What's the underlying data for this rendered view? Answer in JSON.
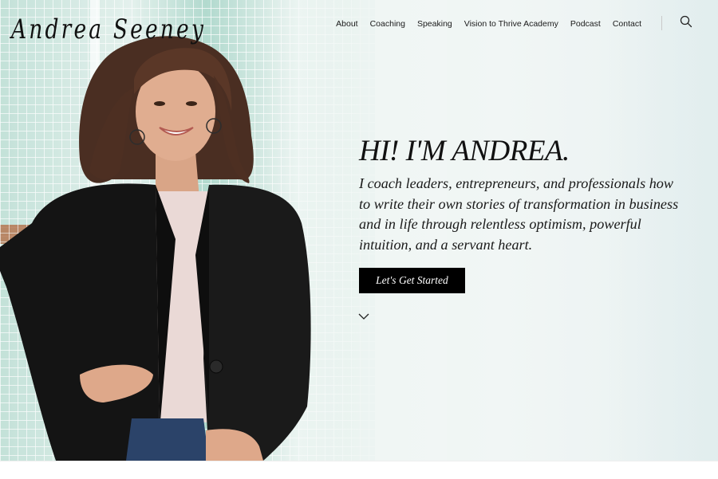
{
  "brand": {
    "name": "Andrea Seeney"
  },
  "nav": {
    "items": [
      {
        "label": "About"
      },
      {
        "label": "Coaching"
      },
      {
        "label": "Speaking"
      },
      {
        "label": "Vision to Thrive Academy"
      },
      {
        "label": "Podcast"
      },
      {
        "label": "Contact"
      }
    ],
    "search_icon": "search-icon"
  },
  "hero": {
    "title": "HI! I'M ANDREA.",
    "body": "I coach leaders, entrepreneurs, and professionals how to write their own stories of transformation in business and in life through relentless optimism, powerful intuition, and a servant heart.",
    "cta_label": "Let's Get Started",
    "scroll_icon": "chevron-down-icon"
  },
  "colors": {
    "cta_background": "#000000",
    "cta_text": "#ffffff",
    "text": "#111111",
    "tile_accent": "#a9d6c9"
  }
}
